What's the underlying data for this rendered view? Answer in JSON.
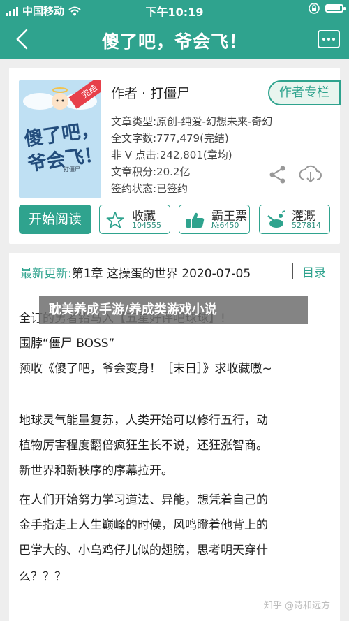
{
  "status_bar": {
    "carrier": "中国移动",
    "time": "下午10:19"
  },
  "nav": {
    "title": "傻了吧，爷会飞！"
  },
  "book": {
    "cover": {
      "title_line1": "傻了吧，",
      "title_line2": "爷会飞！",
      "badge": "完结",
      "small_text": "打僵尸"
    },
    "author": "作者 · 打僵尸",
    "follow_label": "作者专栏",
    "type": "文章类型:原创-纯爱-幻想未来-奇幻",
    "word_count": "全文字数:777,479(完结)",
    "clicks": "非 V 点击:242,801(章均)",
    "score": "文章积分:20.2亿",
    "signed": "签约状态:已签约"
  },
  "actions": {
    "read": "开始阅读",
    "collect": {
      "label": "收藏",
      "count": "104555"
    },
    "overlord": {
      "label": "霸王票",
      "count": "№6450"
    },
    "water": {
      "label": "灌溉",
      "count": "527814"
    }
  },
  "latest": {
    "label": "最新更新:",
    "chapter": "第1章 这操蛋的世界 2020-07-05",
    "toc": "目录"
  },
  "overlay": "耽美养成手游/养成类游戏小说",
  "content": {
    "line1": "全订的男者铅马入【五星好评吧球球】!",
    "line2": "围脖“僵尸 BOSS”",
    "line3": "预收《傻了吧，爷会变身！［末日］》求收藏嗷~",
    "line4": "地球灵气能量复苏，人类开始可以修行五行，动",
    "line5": "植物厉害程度翻倍疯狂生长不说，还狂涨智商。",
    "line6": "新世界和新秩序的序幕拉开。",
    "line7": "在人们开始努力学习道法、异能，想凭着自己的",
    "line8": "金手指走上人生巅峰的时候，风鸣瞪着他背上的",
    "line9": "巴掌大的、小乌鸡仔儿似的翅膀，思考明天穿什",
    "line10": "么？？？"
  },
  "watermark": "知乎 @诗和远方",
  "colors": {
    "primary": "#2fa38e"
  }
}
